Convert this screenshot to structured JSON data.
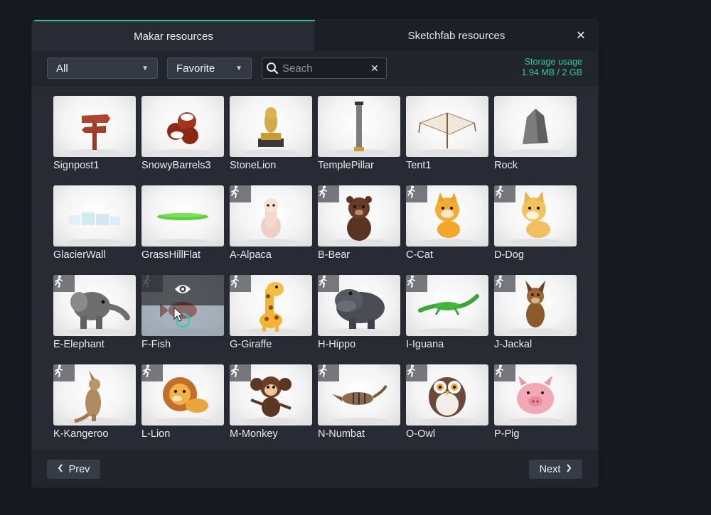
{
  "tabs": [
    "Makar resources",
    "Sketchfab resources"
  ],
  "close_label": "✕",
  "filters": {
    "category": "All",
    "sort": "Favorite"
  },
  "search": {
    "placeholder": "Seach",
    "clear_label": "✕"
  },
  "storage": {
    "title": "Storage usage",
    "value": "1.94 MB / 2 GB"
  },
  "items": [
    {
      "name": "Signpost1",
      "kind": "signpost",
      "animated": false
    },
    {
      "name": "SnowyBarrels3",
      "kind": "barrels",
      "animated": false
    },
    {
      "name": "StoneLion",
      "kind": "statue",
      "animated": false
    },
    {
      "name": "TemplePillar",
      "kind": "pillar",
      "animated": false
    },
    {
      "name": "Tent1",
      "kind": "tent",
      "animated": false
    },
    {
      "name": "Rock",
      "kind": "rock",
      "animated": false
    },
    {
      "name": "GlacierWall",
      "kind": "glacier",
      "animated": false
    },
    {
      "name": "GrassHillFlat",
      "kind": "grass",
      "animated": false
    },
    {
      "name": "A-Alpaca",
      "kind": "alpaca",
      "animated": true
    },
    {
      "name": "B-Bear",
      "kind": "bear",
      "animated": true
    },
    {
      "name": "C-Cat",
      "kind": "cat",
      "animated": true
    },
    {
      "name": "D-Dog",
      "kind": "dog",
      "animated": true
    },
    {
      "name": "E-Elephant",
      "kind": "elephant",
      "animated": true
    },
    {
      "name": "F-Fish",
      "kind": "fish",
      "animated": true,
      "hovered": true
    },
    {
      "name": "G-Giraffe",
      "kind": "giraffe",
      "animated": true
    },
    {
      "name": "H-Hippo",
      "kind": "hippo",
      "animated": true
    },
    {
      "name": "I-Iguana",
      "kind": "iguana",
      "animated": true
    },
    {
      "name": "J-Jackal",
      "kind": "jackal",
      "animated": true
    },
    {
      "name": "K-Kangeroo",
      "kind": "kangaroo",
      "animated": true
    },
    {
      "name": "L-Lion",
      "kind": "lion",
      "animated": true
    },
    {
      "name": "M-Monkey",
      "kind": "monkey",
      "animated": true
    },
    {
      "name": "N-Numbat",
      "kind": "numbat",
      "animated": true
    },
    {
      "name": "O-Owl",
      "kind": "owl",
      "animated": true
    },
    {
      "name": "P-Pig",
      "kind": "pig",
      "animated": true
    }
  ],
  "pagination": {
    "prev_label": "Prev",
    "next_label": "Next"
  },
  "icons": {
    "close": "close-icon",
    "chevron": "chevron-down-icon",
    "search": "search-icon",
    "animated": "running-person-icon",
    "preview": "eye-icon",
    "prev": "chevron-left-icon",
    "next": "chevron-right-icon"
  },
  "colors": {
    "accent": "#3ab89a",
    "storage": "#34c79b",
    "panel": "#262b33",
    "background": "#15181e"
  }
}
